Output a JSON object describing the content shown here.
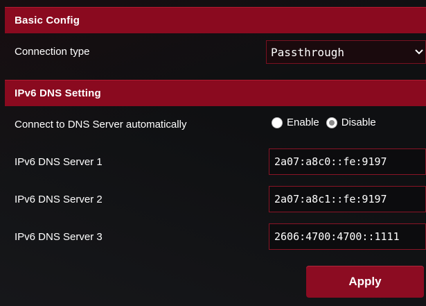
{
  "basic_config": {
    "title": "Basic Config",
    "connection_type_label": "Connection type",
    "connection_type_value": "Passthrough"
  },
  "ipv6_dns": {
    "title": "IPv6 DNS Setting",
    "auto_label": "Connect to DNS Server automatically",
    "enable_label": "Enable",
    "disable_label": "Disable",
    "selected": "Disable",
    "servers": [
      {
        "label": "IPv6 DNS Server 1",
        "value": "2a07:a8c0::fe:9197"
      },
      {
        "label": "IPv6 DNS Server 2",
        "value": "2a07:a8c1::fe:9197"
      },
      {
        "label": "IPv6 DNS Server 3",
        "value": "2606:4700:4700::1111"
      }
    ]
  },
  "apply_label": "Apply",
  "icons": {
    "dropdown": "chevron-down-icon",
    "radio": "radio-icon"
  },
  "colors": {
    "accent": "#8a0a1f",
    "background": "#0f1012"
  }
}
